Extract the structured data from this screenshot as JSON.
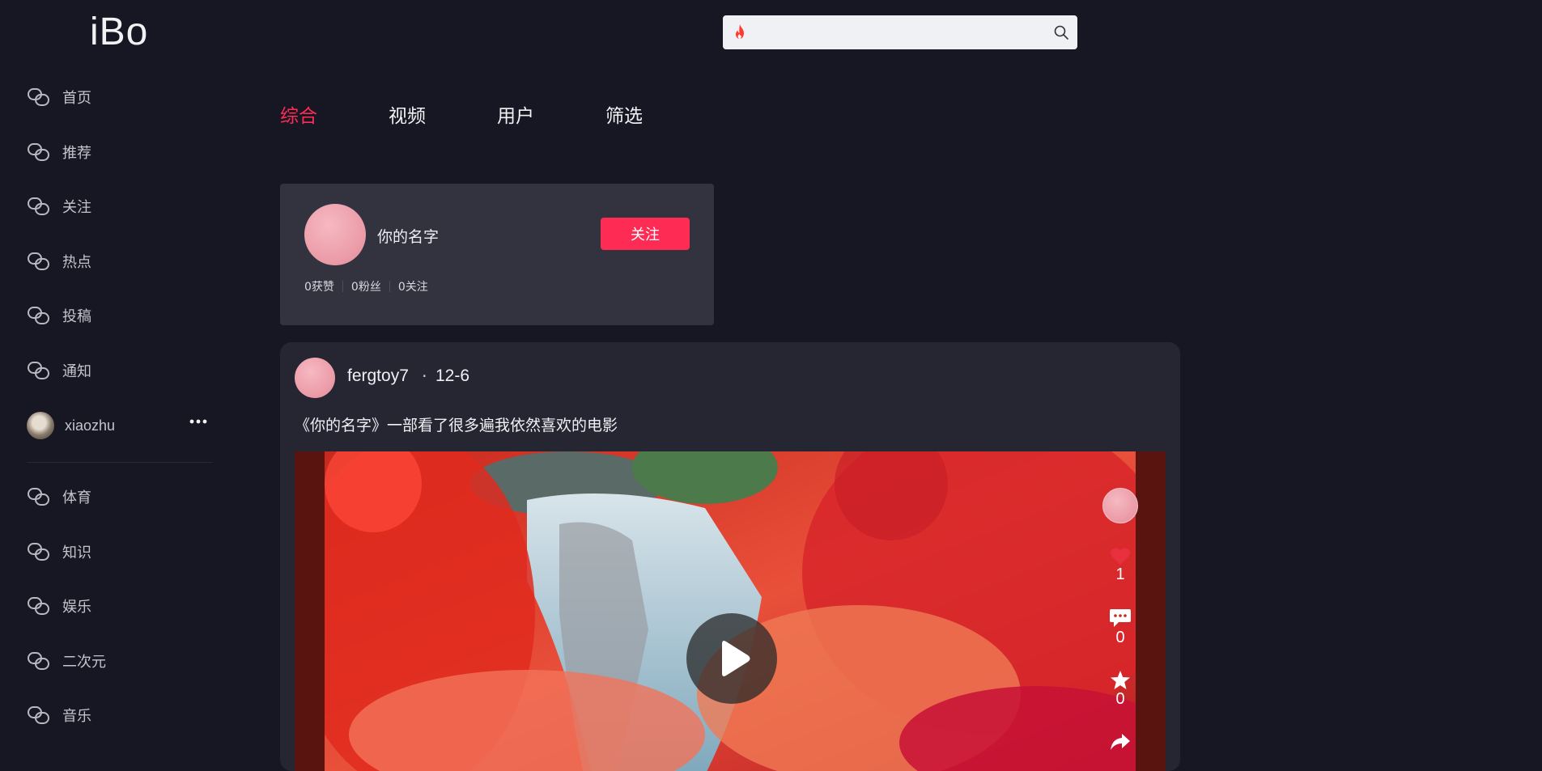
{
  "app": {
    "logo": "iBo"
  },
  "search": {
    "value": "",
    "placeholder": ""
  },
  "sidebar": {
    "items": [
      {
        "label": "首页"
      },
      {
        "label": "推荐"
      },
      {
        "label": "关注"
      },
      {
        "label": "热点"
      },
      {
        "label": "投稿"
      },
      {
        "label": "通知"
      }
    ],
    "user": {
      "name": "xiaozhu",
      "more": "•••"
    },
    "categories": [
      {
        "label": "体育"
      },
      {
        "label": "知识"
      },
      {
        "label": "娱乐"
      },
      {
        "label": "二次元"
      },
      {
        "label": "音乐"
      }
    ]
  },
  "tabs": [
    {
      "label": "综合",
      "active": true
    },
    {
      "label": "视频"
    },
    {
      "label": "用户"
    },
    {
      "label": "筛选"
    }
  ],
  "user_card": {
    "name": "你的名字",
    "follow_label": "关注",
    "stats": [
      "0获赞",
      "0粉丝",
      "0关注"
    ]
  },
  "post": {
    "author": "fergtoy7",
    "separator": "·",
    "date": "12-6",
    "caption": "《你的名字》一部看了很多遍我依然喜欢的电影",
    "likes": "1",
    "comments": "0",
    "favorites": "0"
  },
  "colors": {
    "accent": "#fe2c55",
    "background": "#161722",
    "card": "#333340",
    "post": "#252632"
  }
}
